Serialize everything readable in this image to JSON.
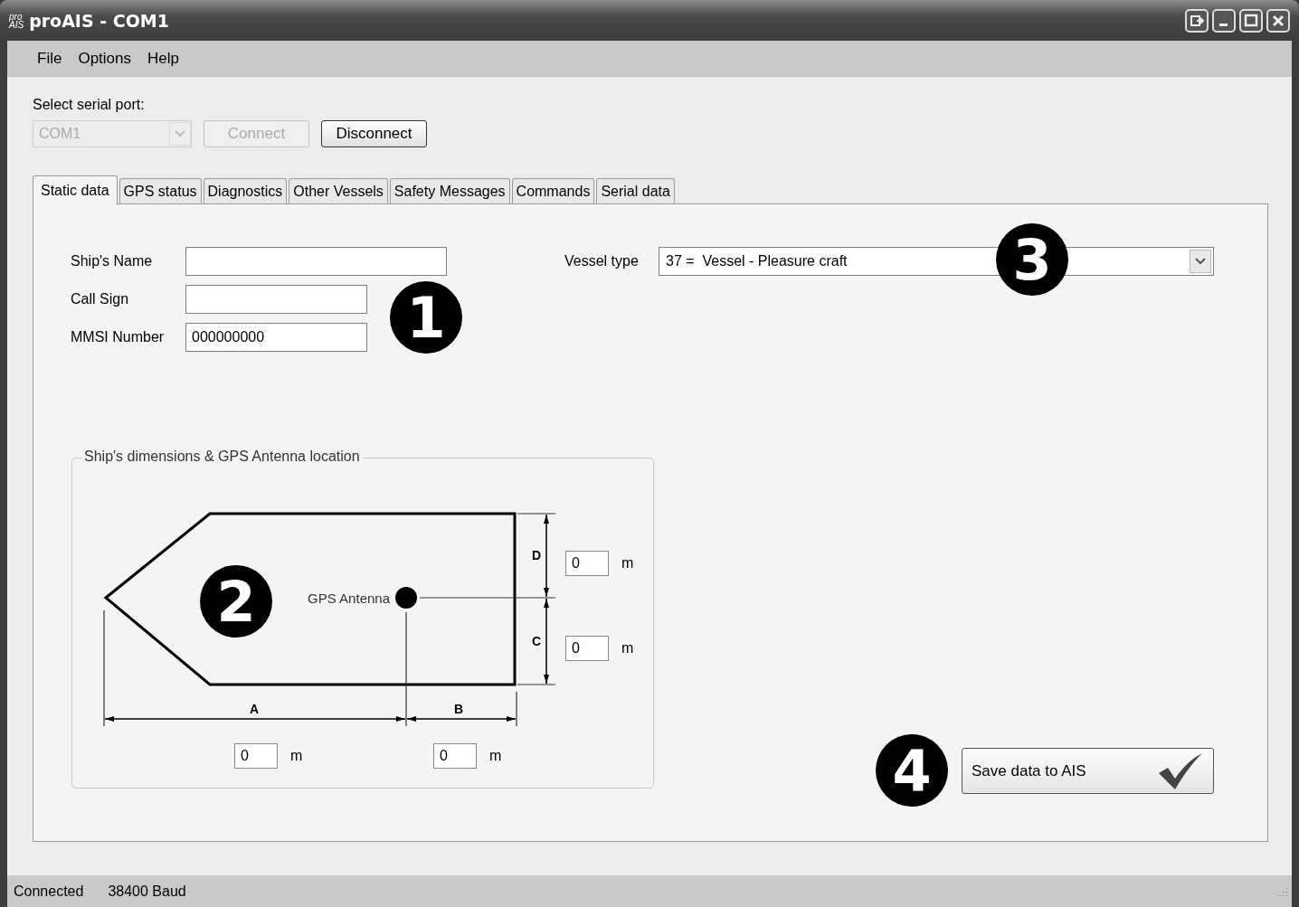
{
  "window": {
    "title": "proAIS - COM1",
    "logo_top": "pro",
    "logo_bottom": "AIS"
  },
  "menu": [
    {
      "label": "File"
    },
    {
      "label": "Options"
    },
    {
      "label": "Help"
    }
  ],
  "serial_port": {
    "label": "Select serial port:",
    "value": "COM1",
    "disabled": true
  },
  "buttons": [
    {
      "label": "Connect",
      "disabled": true
    },
    {
      "label": "Disconnect",
      "disabled": false
    }
  ],
  "tabs": [
    {
      "label": "Static data",
      "selected": true
    },
    {
      "label": "GPS status",
      "selected": false
    },
    {
      "label": "Diagnostics",
      "selected": false
    },
    {
      "label": "Other Vessels",
      "selected": false
    },
    {
      "label": "Safety Messages",
      "selected": false
    },
    {
      "label": "Commands",
      "selected": false
    },
    {
      "label": "Serial data",
      "selected": false
    }
  ],
  "fields": [
    {
      "label": "Ship's Name"
    },
    {
      "label": "Call Sign"
    },
    {
      "label": "MMSI Number",
      "value": "000000000"
    }
  ],
  "vessel_type": {
    "label": "Vessel type",
    "value": "37 =  Vessel - Pleasure craft"
  },
  "dimensions": {
    "title": "Ship's dimensions & GPS Antenna location",
    "antenna_label": "GPS Antenna",
    "marks": [
      {
        "label": "D",
        "value": "0",
        "unit": "m"
      },
      {
        "label": "C",
        "value": "0",
        "unit": "m"
      },
      {
        "label": "A",
        "value": "0",
        "unit": "m"
      },
      {
        "label": "B",
        "value": "0",
        "unit": "m"
      }
    ]
  },
  "save_button": {
    "label": "Save data to AIS"
  },
  "callouts": [
    "1",
    "2",
    "3",
    "4"
  ],
  "status_bar": [
    "Connected",
    "38400 Baud"
  ]
}
